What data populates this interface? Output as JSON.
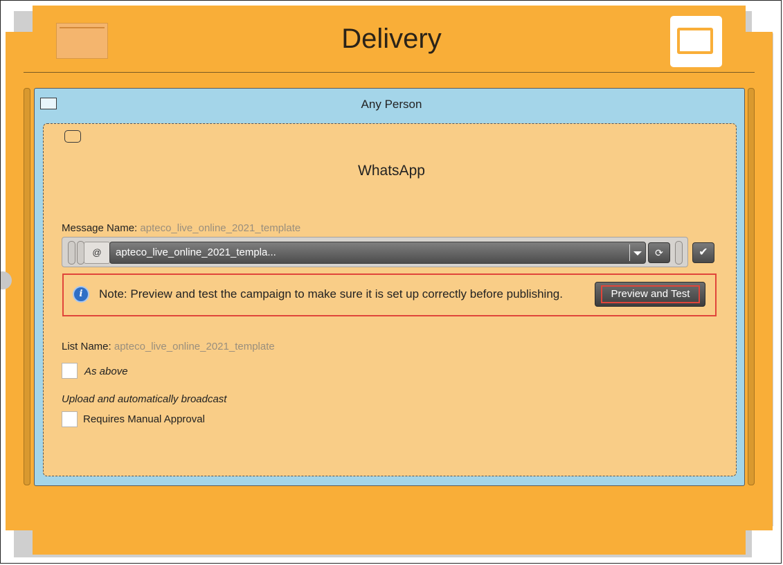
{
  "header": {
    "title": "Delivery",
    "left_icon": "folder-icon",
    "right_icon": "window-icon"
  },
  "panel": {
    "title": "Any Person",
    "checkbox_icon": "panel-checkbox-icon"
  },
  "channel": {
    "title": "WhatsApp",
    "icon": "channel-icon"
  },
  "message": {
    "label": "Message Name:",
    "value": "apteco_live_online_2021_template",
    "at_symbol": "@",
    "selected": "apteco_live_online_2021_templa...",
    "refresh_glyph": "⟳",
    "confirm_glyph": "✔"
  },
  "note": {
    "text": "Note: Preview and test the campaign to make sure it is set up correctly before publishing.",
    "button": "Preview and Test",
    "info_glyph": "i"
  },
  "list": {
    "label": "List Name:",
    "value": "apteco_live_online_2021_template",
    "as_above": "As above"
  },
  "upload": {
    "label": "Upload and automatically broadcast",
    "requires_approval": "Requires Manual Approval"
  },
  "colors": {
    "card": "#f9ae38",
    "panel": "#a4d5e9",
    "inner": "#f9cd87",
    "highlight": "#e0453a"
  }
}
